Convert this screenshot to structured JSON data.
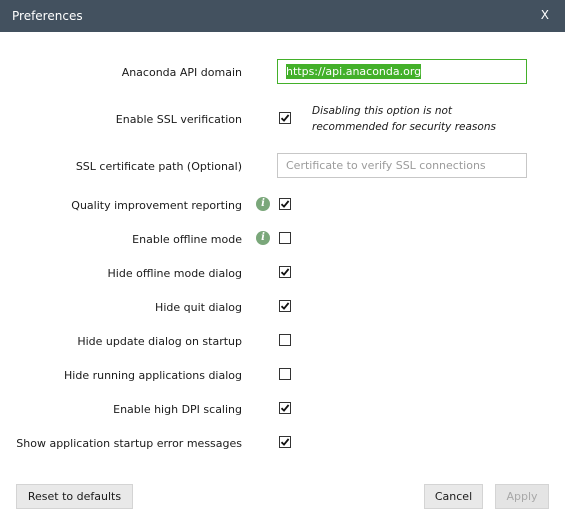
{
  "window": {
    "title": "Preferences",
    "close_label": "X"
  },
  "fields": {
    "api_domain_label": "Anaconda API domain",
    "api_domain_value": "https://api.anaconda.org",
    "ssl_label": "Enable SSL verification",
    "ssl_note_line1": "Disabling this option is not",
    "ssl_note_line2": "recommended for security reasons",
    "cert_label": "SSL certificate path (Optional)",
    "cert_placeholder": "Certificate to verify SSL connections"
  },
  "options": [
    {
      "label": "Quality improvement reporting",
      "checked": true,
      "info": true
    },
    {
      "label": "Enable offline mode",
      "checked": false,
      "info": true
    },
    {
      "label": "Hide offline mode dialog",
      "checked": true,
      "info": false
    },
    {
      "label": "Hide quit dialog",
      "checked": true,
      "info": false
    },
    {
      "label": "Hide update dialog on startup",
      "checked": false,
      "info": false
    },
    {
      "label": "Hide running applications dialog",
      "checked": false,
      "info": false
    },
    {
      "label": "Enable high DPI scaling",
      "checked": true,
      "info": false
    },
    {
      "label": "Show application startup error messages",
      "checked": true,
      "info": false
    }
  ],
  "ssl_checked": true,
  "info_icon_glyph": "i",
  "buttons": {
    "reset": "Reset to defaults",
    "cancel": "Cancel",
    "apply": "Apply"
  },
  "colors": {
    "titlebar": "#43515f",
    "accent": "#43b02a",
    "info_icon": "#7aa77a"
  }
}
